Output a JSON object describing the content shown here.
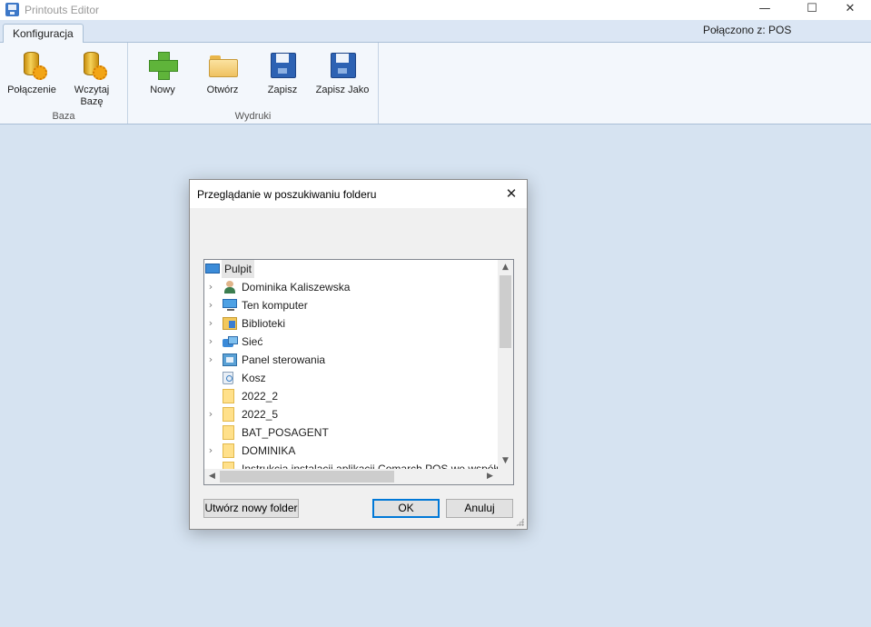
{
  "app": {
    "title": "Printouts Editor",
    "window_controls": {
      "minimize": "—",
      "maximize": "☐",
      "close": "✕"
    }
  },
  "ribbon": {
    "tab": "Konfiguracja",
    "status": "Połączono z: POS",
    "groups": [
      {
        "label": "Baza",
        "buttons": [
          {
            "label": "Połączenie",
            "icon": "database-icon"
          },
          {
            "label": "Wczytaj Bazę",
            "icon": "database-load-icon"
          }
        ]
      },
      {
        "label": "Wydruki",
        "buttons": [
          {
            "label": "Nowy",
            "icon": "plus-icon"
          },
          {
            "label": "Otwórz",
            "icon": "folder-open-icon"
          },
          {
            "label": "Zapisz",
            "icon": "floppy-disk-icon"
          },
          {
            "label": "Zapisz Jako",
            "icon": "floppy-disk-icon"
          }
        ]
      }
    ]
  },
  "dialog": {
    "title": "Przeglądanie w poszukiwaniu folderu",
    "close": "✕",
    "tree": [
      {
        "label": "Pulpit",
        "icon": "desktop-icon",
        "expander": "",
        "selected": true
      },
      {
        "label": "Dominika Kaliszewska",
        "icon": "user-icon",
        "expander": "›"
      },
      {
        "label": "Ten komputer",
        "icon": "computer-icon",
        "expander": "›"
      },
      {
        "label": "Biblioteki",
        "icon": "libraries-icon",
        "expander": "›"
      },
      {
        "label": "Sieć",
        "icon": "network-icon",
        "expander": "›"
      },
      {
        "label": "Panel sterowania",
        "icon": "control-panel-icon",
        "expander": "›"
      },
      {
        "label": "Kosz",
        "icon": "recycle-bin-icon",
        "expander": ""
      },
      {
        "label": "2022_2",
        "icon": "folder-icon",
        "expander": ""
      },
      {
        "label": "2022_5",
        "icon": "folder-icon",
        "expander": "›"
      },
      {
        "label": "BAT_POSAGENT",
        "icon": "folder-icon",
        "expander": ""
      },
      {
        "label": "DOMINIKA",
        "icon": "folder-icon",
        "expander": "›"
      },
      {
        "label": "Instrukcja instalacji aplikacji Comarch POS we współp",
        "icon": "folder-icon",
        "expander": ""
      }
    ],
    "scroll_arrows": {
      "up": "▲",
      "down": "▼",
      "left": "◀",
      "right": "▶"
    },
    "buttons": {
      "new_folder": "Utwórz nowy folder",
      "ok": "OK",
      "cancel": "Anuluj"
    }
  }
}
